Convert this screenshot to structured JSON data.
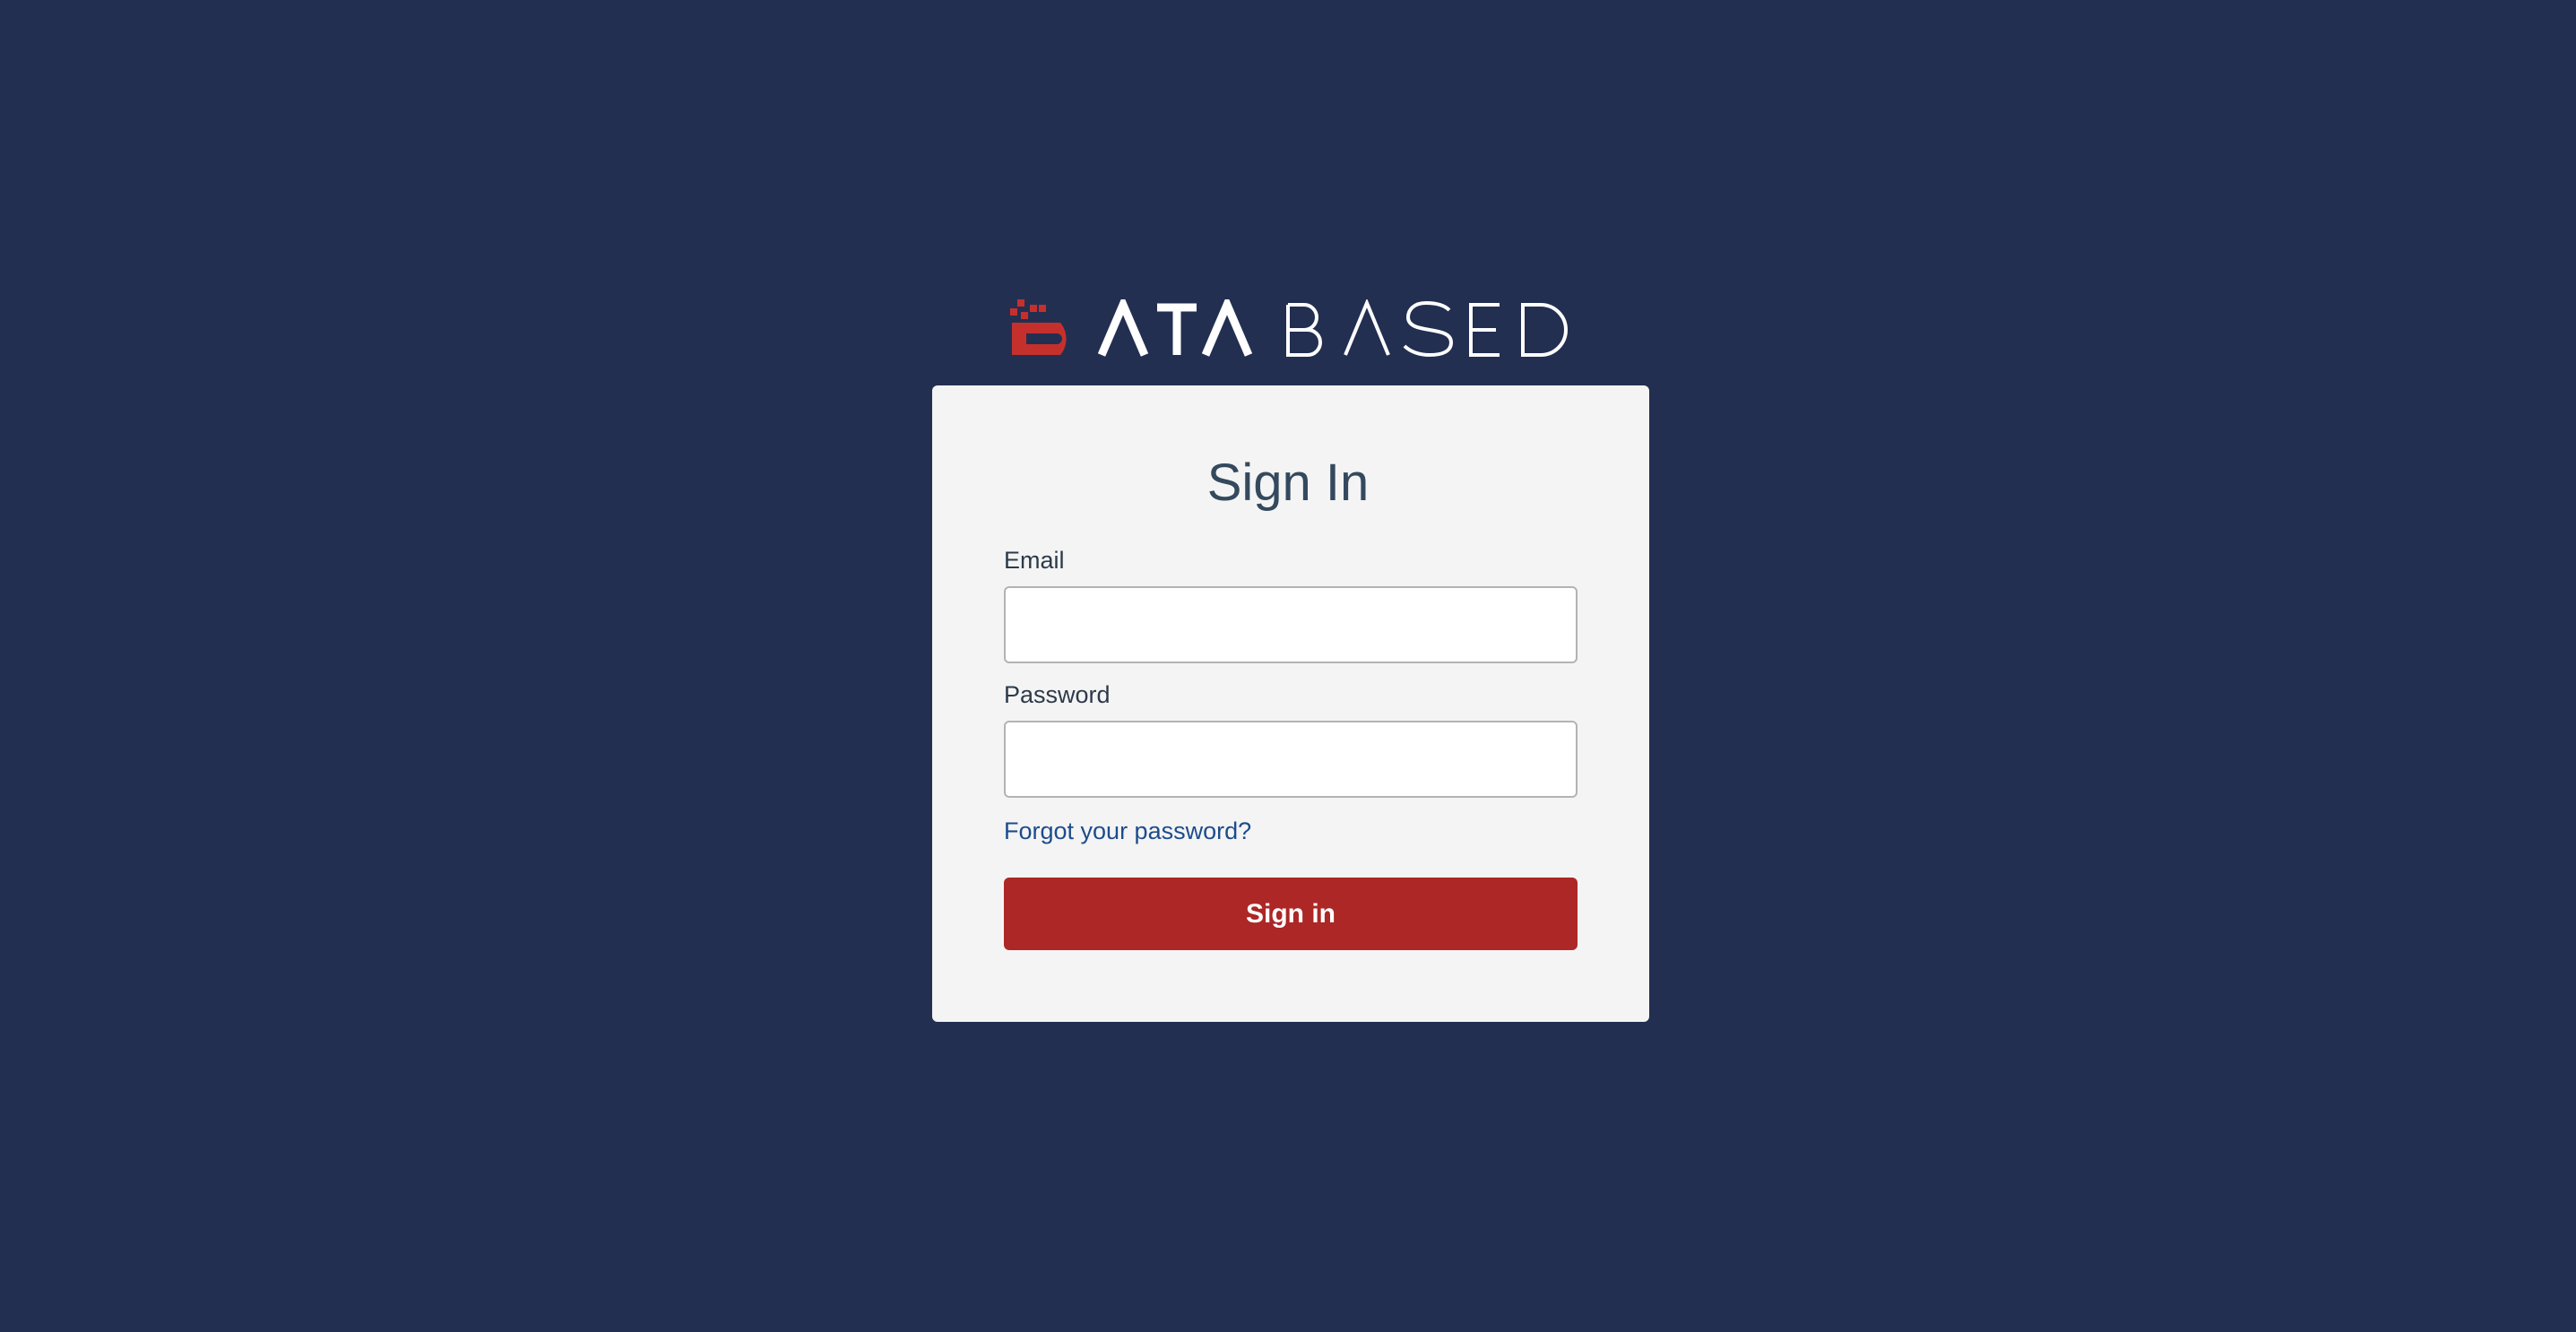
{
  "brand": {
    "name": "DATABASED",
    "accent_color": "#c5302d",
    "background_color": "#232f51"
  },
  "signin_card": {
    "title": "Sign In",
    "email_label": "Email",
    "email_value": "",
    "password_label": "Password",
    "password_value": "",
    "forgot_link": "Forgot your password?",
    "submit_label": "Sign in",
    "submit_color": "#ac2725"
  }
}
